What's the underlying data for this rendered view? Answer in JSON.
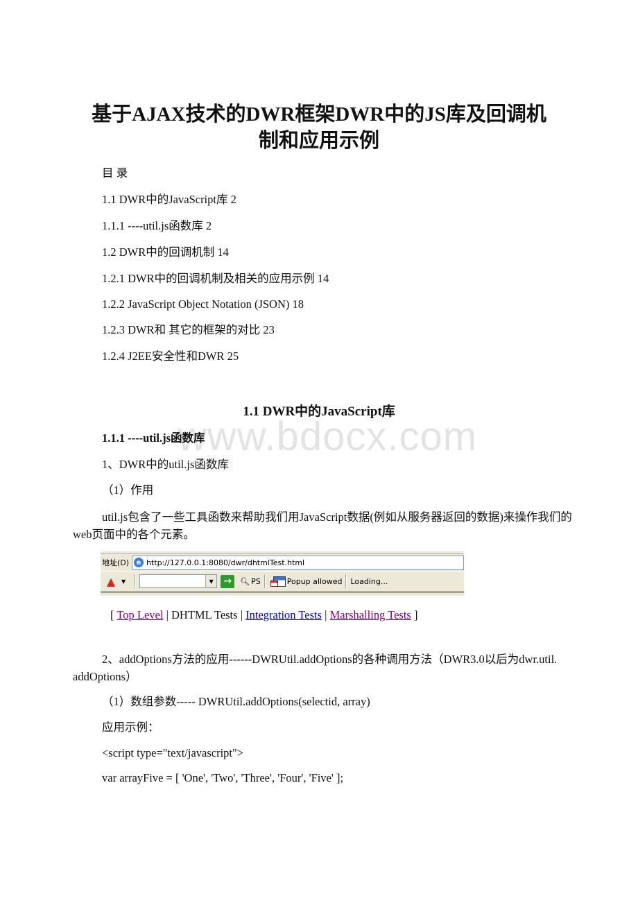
{
  "document": {
    "title_line1": "基于AJAX技术的DWR框架DWR中的JS库及回调机",
    "title_line2": "制和应用示例",
    "toc_heading": "目 录",
    "toc": [
      {
        "text": "1.1 DWR中的JavaScript库 2"
      },
      {
        "text": "1.1.1 ----util.js函数库 2"
      },
      {
        "text": "1.2 DWR中的回调机制 14"
      },
      {
        "text": "1.2.1 DWR中的回调机制及相关的应用示例 14"
      },
      {
        "text": "1.2.2 JavaScript Object Notation (JSON) 18"
      },
      {
        "text": "1.2.3 DWR和 其它的框架的对比 23"
      },
      {
        "text": "1.2.4 J2EE安全性和DWR 25"
      }
    ],
    "section_heading": "1.1 DWR中的JavaScript库",
    "subsection_heading": "1.1.1 ----util.js函数库",
    "watermark": "www.bdocx.com",
    "item1": "1、DWR中的util.js函数库",
    "item1_sub": "（1）作用",
    "para1": "util.js包含了一些工具函数来帮助我们用JavaScript数据(例如从服务器返回的数据)来操作我们的web页面中的各个元素。",
    "para2": "2、addOptions方法的应用------DWRUtil.addOptions的各种调用方法（DWR3.0以后为dwr.util. addOptions）",
    "item2_sub": "（1）数组参数----- DWRUtil.addOptions(selectid, array)",
    "example_label": "应用示例：",
    "code_line1": "<script type=\"text/javascript\">",
    "code_line2": "var arrayFive = [ 'One', 'Two', 'Three', 'Four', 'Five' ];"
  },
  "browser_screenshot": {
    "address_label": "地址(D)",
    "url": "http://127.0.0.1:8080/dwr/dhtmlTest.html",
    "search_value": "",
    "ps_label": "PS",
    "popup_label": "Popup allowed",
    "status_label": "Loading..."
  },
  "nav_links": {
    "open": "[",
    "sep": "|",
    "close": "]",
    "items": [
      {
        "label": "Top Level",
        "link": true
      },
      {
        "label": "DHTML Tests",
        "link": false
      },
      {
        "label": "Integration Tests",
        "link": true
      },
      {
        "label": "Marshalling Tests",
        "link": true
      }
    ]
  }
}
